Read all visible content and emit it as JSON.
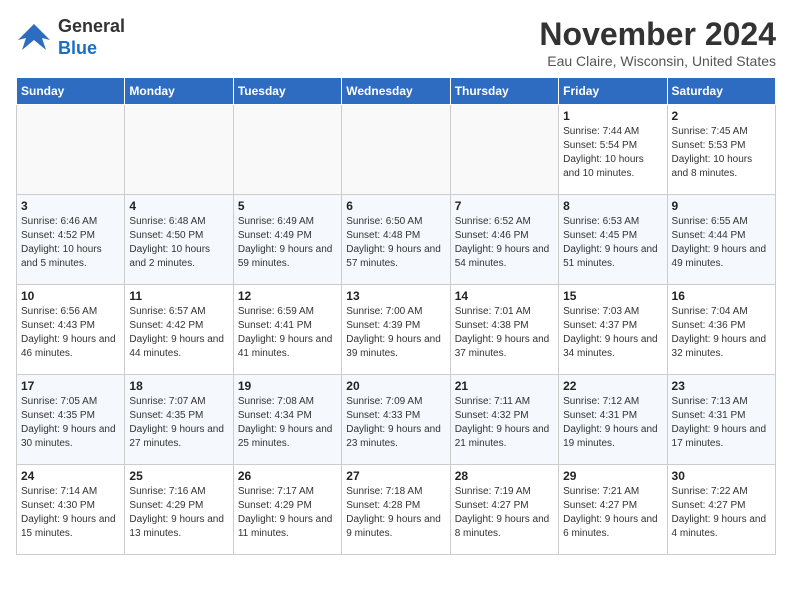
{
  "logo": {
    "general": "General",
    "blue": "Blue"
  },
  "header": {
    "month": "November 2024",
    "location": "Eau Claire, Wisconsin, United States"
  },
  "weekdays": [
    "Sunday",
    "Monday",
    "Tuesday",
    "Wednesday",
    "Thursday",
    "Friday",
    "Saturday"
  ],
  "weeks": [
    [
      {
        "day": "",
        "info": ""
      },
      {
        "day": "",
        "info": ""
      },
      {
        "day": "",
        "info": ""
      },
      {
        "day": "",
        "info": ""
      },
      {
        "day": "",
        "info": ""
      },
      {
        "day": "1",
        "info": "Sunrise: 7:44 AM\nSunset: 5:54 PM\nDaylight: 10 hours and 10 minutes."
      },
      {
        "day": "2",
        "info": "Sunrise: 7:45 AM\nSunset: 5:53 PM\nDaylight: 10 hours and 8 minutes."
      }
    ],
    [
      {
        "day": "3",
        "info": "Sunrise: 6:46 AM\nSunset: 4:52 PM\nDaylight: 10 hours and 5 minutes."
      },
      {
        "day": "4",
        "info": "Sunrise: 6:48 AM\nSunset: 4:50 PM\nDaylight: 10 hours and 2 minutes."
      },
      {
        "day": "5",
        "info": "Sunrise: 6:49 AM\nSunset: 4:49 PM\nDaylight: 9 hours and 59 minutes."
      },
      {
        "day": "6",
        "info": "Sunrise: 6:50 AM\nSunset: 4:48 PM\nDaylight: 9 hours and 57 minutes."
      },
      {
        "day": "7",
        "info": "Sunrise: 6:52 AM\nSunset: 4:46 PM\nDaylight: 9 hours and 54 minutes."
      },
      {
        "day": "8",
        "info": "Sunrise: 6:53 AM\nSunset: 4:45 PM\nDaylight: 9 hours and 51 minutes."
      },
      {
        "day": "9",
        "info": "Sunrise: 6:55 AM\nSunset: 4:44 PM\nDaylight: 9 hours and 49 minutes."
      }
    ],
    [
      {
        "day": "10",
        "info": "Sunrise: 6:56 AM\nSunset: 4:43 PM\nDaylight: 9 hours and 46 minutes."
      },
      {
        "day": "11",
        "info": "Sunrise: 6:57 AM\nSunset: 4:42 PM\nDaylight: 9 hours and 44 minutes."
      },
      {
        "day": "12",
        "info": "Sunrise: 6:59 AM\nSunset: 4:41 PM\nDaylight: 9 hours and 41 minutes."
      },
      {
        "day": "13",
        "info": "Sunrise: 7:00 AM\nSunset: 4:39 PM\nDaylight: 9 hours and 39 minutes."
      },
      {
        "day": "14",
        "info": "Sunrise: 7:01 AM\nSunset: 4:38 PM\nDaylight: 9 hours and 37 minutes."
      },
      {
        "day": "15",
        "info": "Sunrise: 7:03 AM\nSunset: 4:37 PM\nDaylight: 9 hours and 34 minutes."
      },
      {
        "day": "16",
        "info": "Sunrise: 7:04 AM\nSunset: 4:36 PM\nDaylight: 9 hours and 32 minutes."
      }
    ],
    [
      {
        "day": "17",
        "info": "Sunrise: 7:05 AM\nSunset: 4:35 PM\nDaylight: 9 hours and 30 minutes."
      },
      {
        "day": "18",
        "info": "Sunrise: 7:07 AM\nSunset: 4:35 PM\nDaylight: 9 hours and 27 minutes."
      },
      {
        "day": "19",
        "info": "Sunrise: 7:08 AM\nSunset: 4:34 PM\nDaylight: 9 hours and 25 minutes."
      },
      {
        "day": "20",
        "info": "Sunrise: 7:09 AM\nSunset: 4:33 PM\nDaylight: 9 hours and 23 minutes."
      },
      {
        "day": "21",
        "info": "Sunrise: 7:11 AM\nSunset: 4:32 PM\nDaylight: 9 hours and 21 minutes."
      },
      {
        "day": "22",
        "info": "Sunrise: 7:12 AM\nSunset: 4:31 PM\nDaylight: 9 hours and 19 minutes."
      },
      {
        "day": "23",
        "info": "Sunrise: 7:13 AM\nSunset: 4:31 PM\nDaylight: 9 hours and 17 minutes."
      }
    ],
    [
      {
        "day": "24",
        "info": "Sunrise: 7:14 AM\nSunset: 4:30 PM\nDaylight: 9 hours and 15 minutes."
      },
      {
        "day": "25",
        "info": "Sunrise: 7:16 AM\nSunset: 4:29 PM\nDaylight: 9 hours and 13 minutes."
      },
      {
        "day": "26",
        "info": "Sunrise: 7:17 AM\nSunset: 4:29 PM\nDaylight: 9 hours and 11 minutes."
      },
      {
        "day": "27",
        "info": "Sunrise: 7:18 AM\nSunset: 4:28 PM\nDaylight: 9 hours and 9 minutes."
      },
      {
        "day": "28",
        "info": "Sunrise: 7:19 AM\nSunset: 4:27 PM\nDaylight: 9 hours and 8 minutes."
      },
      {
        "day": "29",
        "info": "Sunrise: 7:21 AM\nSunset: 4:27 PM\nDaylight: 9 hours and 6 minutes."
      },
      {
        "day": "30",
        "info": "Sunrise: 7:22 AM\nSunset: 4:27 PM\nDaylight: 9 hours and 4 minutes."
      }
    ]
  ]
}
